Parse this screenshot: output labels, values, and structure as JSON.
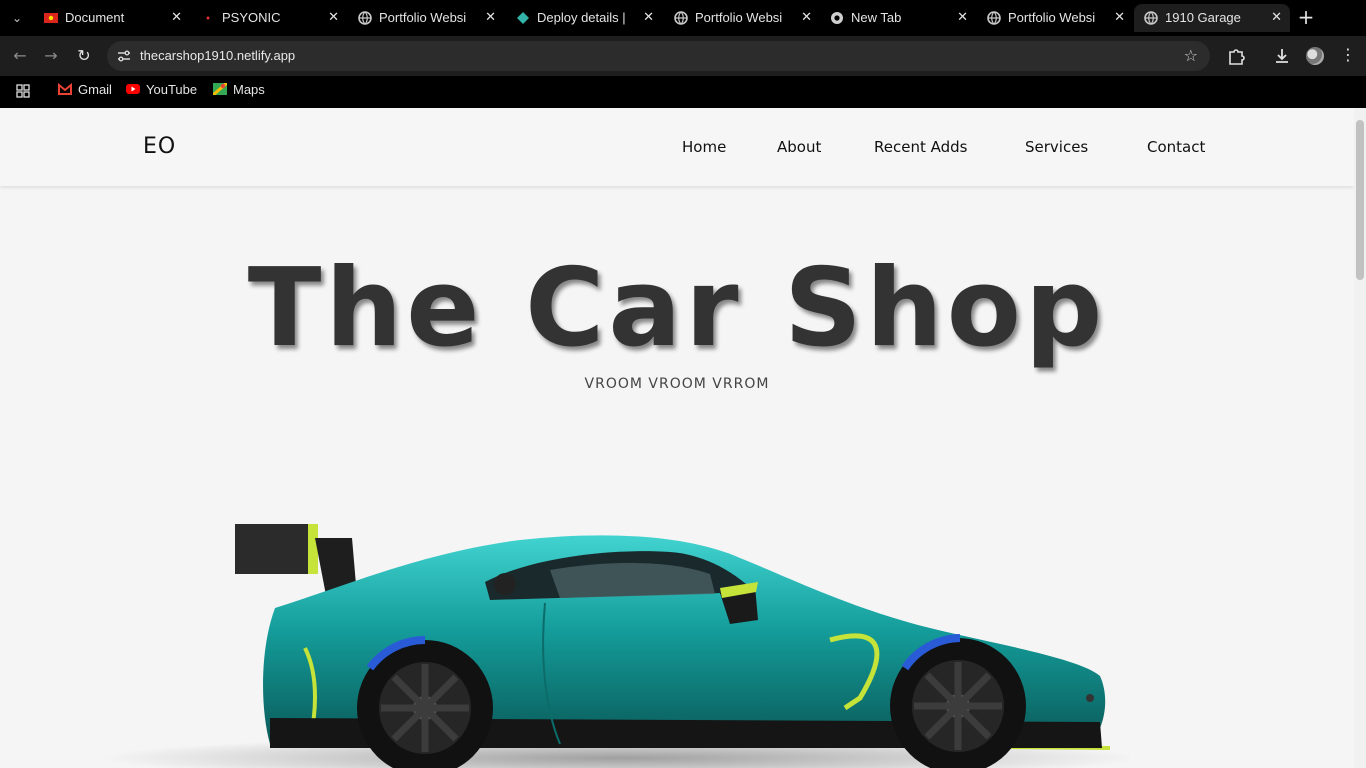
{
  "browser": {
    "tabs": [
      {
        "title": "Document",
        "favicon": "flag-icon",
        "active": false
      },
      {
        "title": "PSYONIC",
        "favicon": "red-dot-icon",
        "active": false
      },
      {
        "title": "Portfolio Websi",
        "favicon": "globe-icon",
        "active": false
      },
      {
        "title": "Deploy details |",
        "favicon": "netlify-icon",
        "active": false
      },
      {
        "title": "Portfolio Websi",
        "favicon": "globe-icon",
        "active": false
      },
      {
        "title": "New Tab",
        "favicon": "chrome-icon",
        "active": false
      },
      {
        "title": "Portfolio Websi",
        "favicon": "globe-icon",
        "active": false
      },
      {
        "title": "1910 Garage",
        "favicon": "globe-icon",
        "active": true
      }
    ],
    "url": "thecarshop1910.netlify.app",
    "bookmarks": [
      {
        "label": "Gmail",
        "icon": "gmail-icon"
      },
      {
        "label": "YouTube",
        "icon": "youtube-icon"
      },
      {
        "label": "Maps",
        "icon": "maps-icon"
      }
    ]
  },
  "site": {
    "logo": "EO",
    "nav": [
      "Home",
      "About",
      "Recent Adds",
      "Services",
      "Contact"
    ],
    "hero_title": "The Car Shop",
    "hero_subtitle": "VROOM VROOM VRROM",
    "hero_image": "race-car-image",
    "colors": {
      "car_teal": "#17a8a6",
      "car_accent": "#c6e339",
      "text": "#333333",
      "background": "#f5f5f5"
    }
  }
}
